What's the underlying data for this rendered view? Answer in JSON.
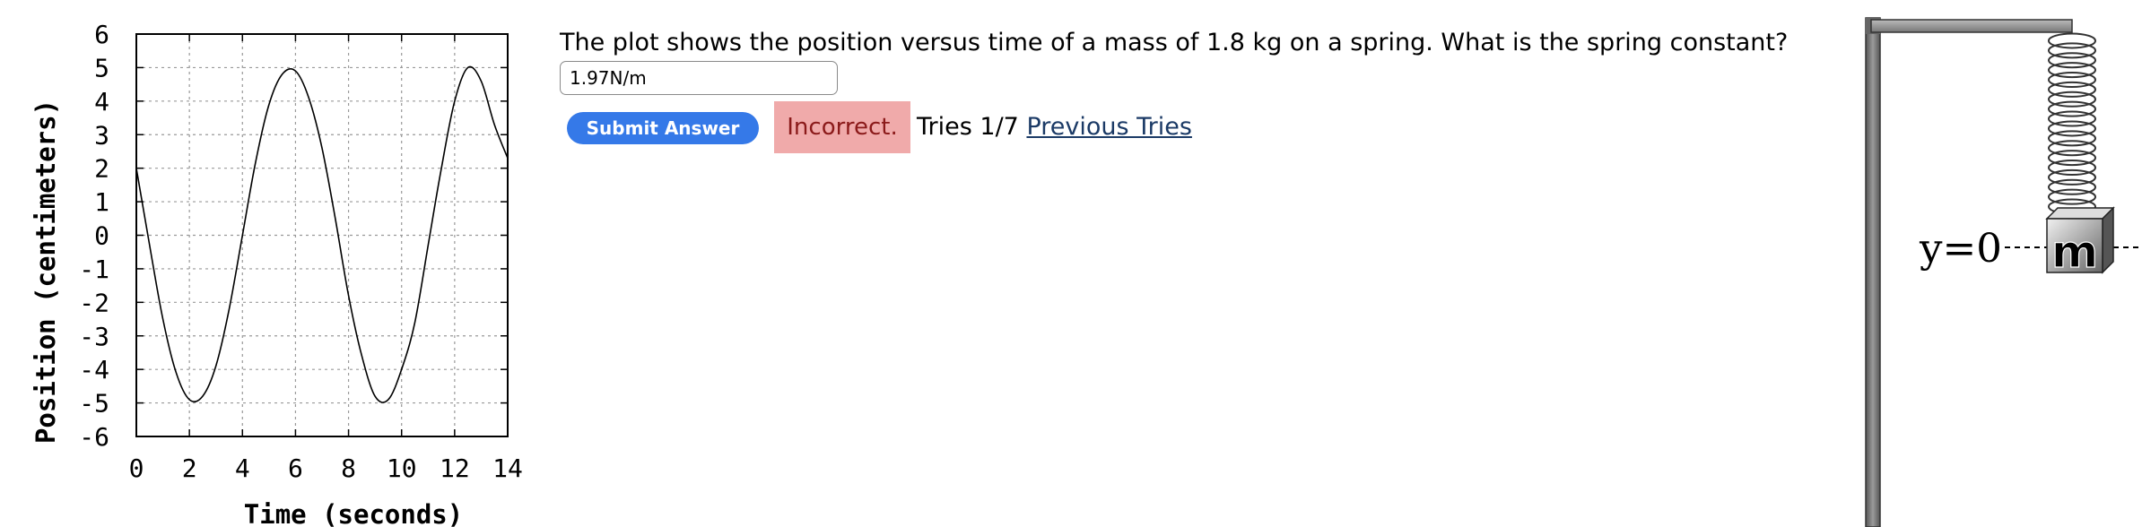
{
  "chart_data": {
    "type": "line",
    "xlabel": "Time (seconds)",
    "ylabel": "Position (centimeters)",
    "xlim": [
      0,
      14
    ],
    "ylim": [
      -6,
      6
    ],
    "x_ticks": [
      "0",
      "2",
      "4",
      "6",
      "8",
      "10",
      "12",
      "14"
    ],
    "y_ticks": [
      "6",
      "5",
      "4",
      "3",
      "2",
      "1",
      "0",
      "-1",
      "-2",
      "-3",
      "-4",
      "-5",
      "-6"
    ],
    "grid": true,
    "x": [
      0,
      0.5,
      1,
      1.5,
      2,
      2.5,
      3,
      3.5,
      4,
      4.5,
      5,
      5.5,
      6,
      6.5,
      7,
      7.5,
      8,
      8.5,
      9,
      9.5,
      10,
      10.5,
      11,
      11.5,
      12,
      12.5,
      13,
      13.5,
      14
    ],
    "y": [
      2.0,
      -0.3,
      -2.5,
      -4.1,
      -4.9,
      -4.8,
      -3.9,
      -2.2,
      0.0,
      2.2,
      3.9,
      4.8,
      4.9,
      4.1,
      2.6,
      0.5,
      -1.8,
      -3.6,
      -4.8,
      -4.9,
      -4.0,
      -2.6,
      -0.3,
      2.0,
      4.0,
      5.0,
      4.6,
      3.3,
      2.3
    ]
  },
  "question": {
    "text": "The plot shows the position versus time of a mass of 1.8 kg on a spring. What is the spring constant?"
  },
  "answer": {
    "value": "1.97N/m"
  },
  "submit_label": "Submit Answer",
  "status": {
    "text": "Incorrect.",
    "color": "#f0aaaa",
    "text_color": "#8b1a1a"
  },
  "tries": {
    "text": "Tries 1/7",
    "link_label": "Previous Tries"
  },
  "diagram": {
    "equilibrium_label": "y=0",
    "mass_label": "m"
  },
  "colors": {
    "button": "#3579e8",
    "link": "#1b3a66"
  }
}
